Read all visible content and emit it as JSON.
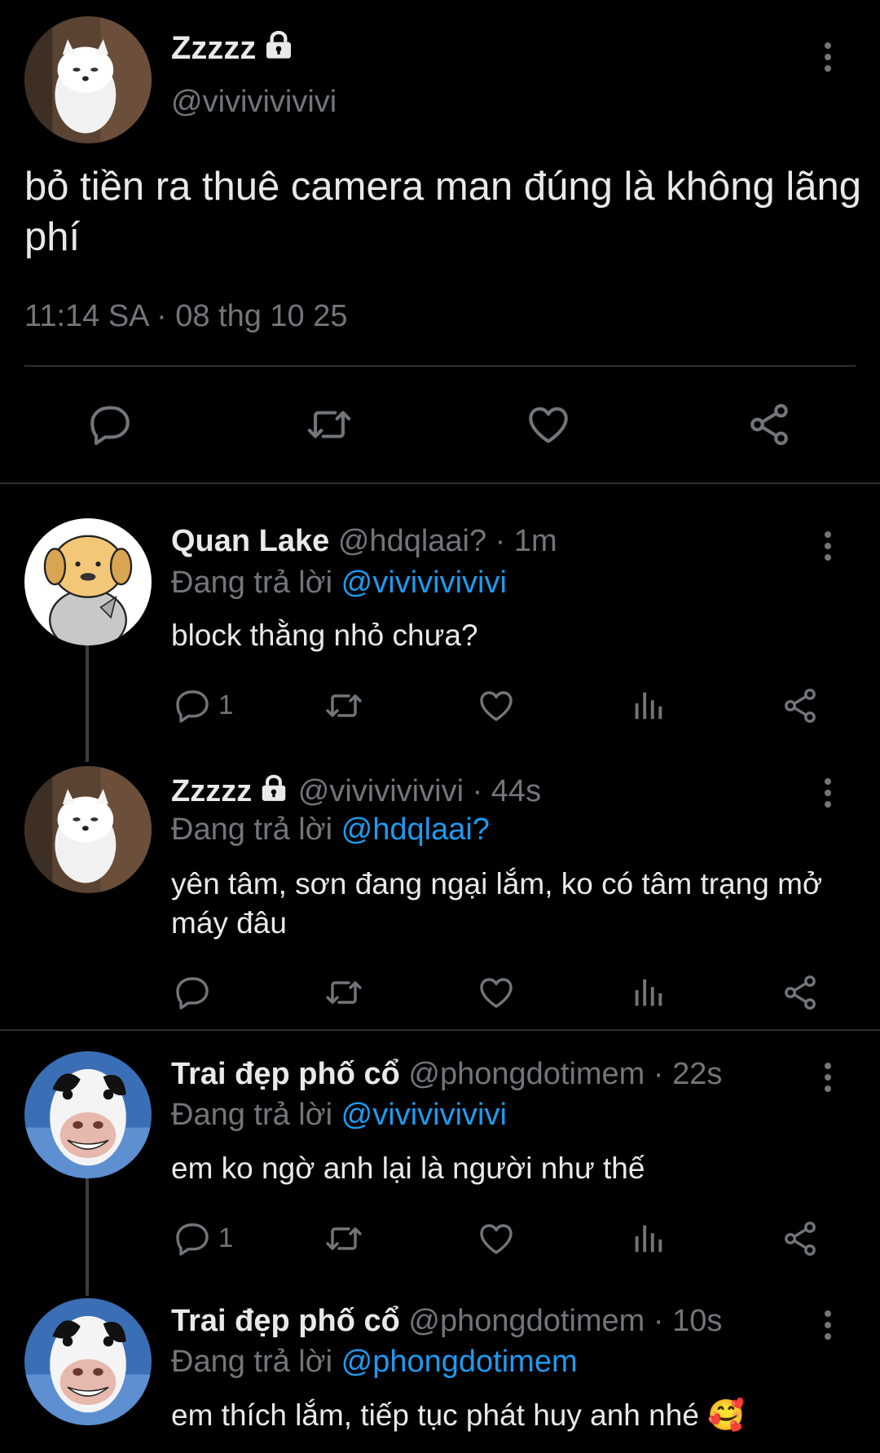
{
  "main_tweet": {
    "author_name": "Zzzzz",
    "handle": "@vivivivivivi",
    "text": "bỏ tiền ra thuê camera man đúng là không lãng phí",
    "time": "11:14 SA",
    "date": "08 thg 10 25",
    "separator": " · "
  },
  "replying_label": "Đang trả lời",
  "replies": [
    {
      "author_name": "Quan Lake",
      "handle": "@hdqlaai?",
      "age": "1m",
      "replying_to": "@vivivivivivi",
      "text": "block thằng nhỏ chưa?",
      "reply_count": "1"
    },
    {
      "author_name": "Zzzzz",
      "handle": "@vivivivivivi",
      "age": "44s",
      "replying_to": "@hdqlaai?",
      "text": "yên tâm, sơn đang ngại lắm, ko có tâm trạng mở máy đâu",
      "reply_count": ""
    },
    {
      "author_name": "Trai đẹp phố cổ",
      "handle": "@phongdotimem",
      "age": "22s",
      "replying_to": "@vivivivivivi",
      "text": "em ko ngờ anh lại là người như thế",
      "reply_count": "1"
    },
    {
      "author_name": "Trai đẹp phố cổ",
      "handle": "@phongdotimem",
      "age": "10s",
      "replying_to": "@phongdotimem",
      "text": "em thích lắm, tiếp tục phát huy anh nhé 🥰",
      "reply_count": ""
    }
  ],
  "colors": {
    "background": "#000000",
    "text": "#e7e9ea",
    "secondary": "#71767b",
    "link": "#1d9bf0",
    "divider": "#2f3336"
  },
  "icons": [
    "lock-icon",
    "more-icon",
    "reply-icon",
    "retweet-icon",
    "like-icon",
    "share-icon",
    "views-icon"
  ]
}
